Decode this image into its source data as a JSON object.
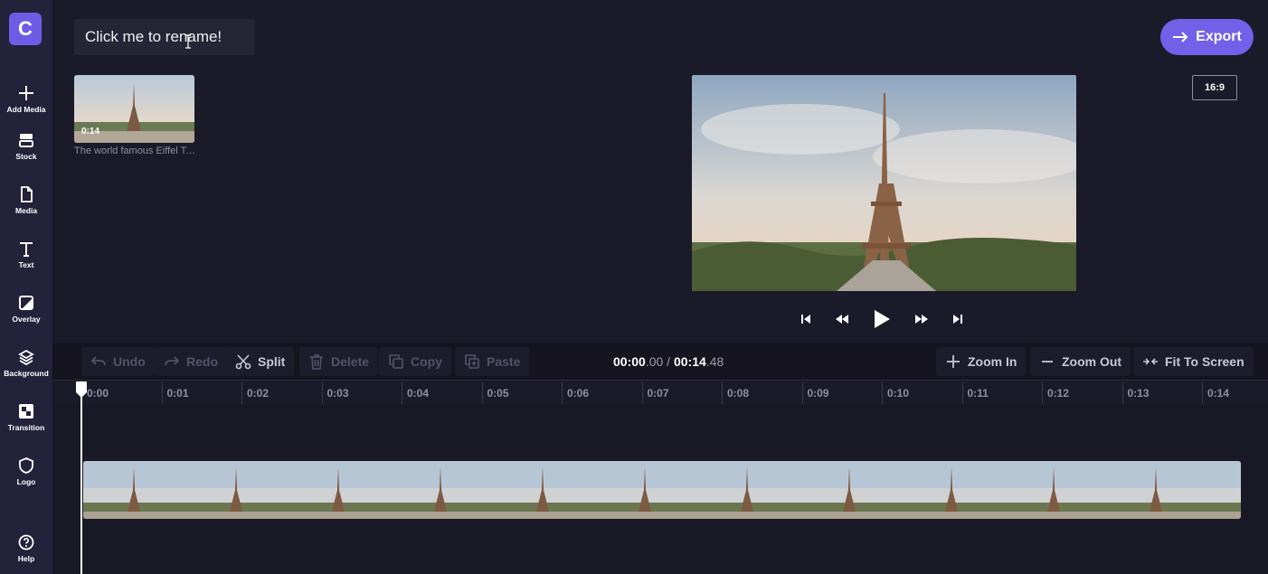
{
  "app": {
    "logo_letter": "C",
    "accent": "#7360e8"
  },
  "sidebar": {
    "items": [
      {
        "label": "Add Media",
        "icon": "plus-icon"
      },
      {
        "label": "Stock",
        "icon": "stock-icon"
      },
      {
        "label": "Media",
        "icon": "file-icon"
      },
      {
        "label": "Text",
        "icon": "text-icon"
      },
      {
        "label": "Overlay",
        "icon": "overlay-icon"
      },
      {
        "label": "Background",
        "icon": "layers-icon"
      },
      {
        "label": "Transition",
        "icon": "transition-icon"
      },
      {
        "label": "Logo",
        "icon": "shield-icon"
      },
      {
        "label": "Help",
        "icon": "help-icon"
      }
    ]
  },
  "header": {
    "project_title": "Click me to rename!",
    "export_label": "Export"
  },
  "media_library": {
    "items": [
      {
        "duration": "0:14",
        "name": "The world famous Eiffel Tower"
      }
    ]
  },
  "preview": {
    "aspect_ratio": "16:9"
  },
  "toolbar": {
    "undo": "Undo",
    "redo": "Redo",
    "split": "Split",
    "delete": "Delete",
    "copy": "Copy",
    "paste": "Paste",
    "zoom_in": "Zoom In",
    "zoom_out": "Zoom Out",
    "fit": "Fit To Screen"
  },
  "timecode": {
    "current_main": "00:00",
    "current_frac": ".00",
    "separator": "/",
    "total_main": "00:14",
    "total_frac": ".48"
  },
  "ruler": {
    "ticks": [
      "0:00",
      "0:01",
      "0:02",
      "0:03",
      "0:04",
      "0:05",
      "0:06",
      "0:07",
      "0:08",
      "0:09",
      "0:10",
      "0:11",
      "0:12",
      "0:13",
      "0:14"
    ]
  }
}
